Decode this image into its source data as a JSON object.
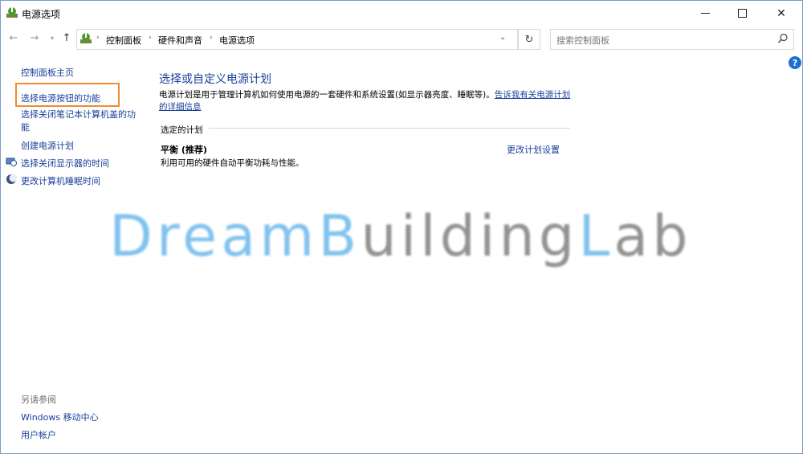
{
  "window": {
    "title": "电源选项",
    "buttons": {
      "minimize": "minimize",
      "maximize": "maximize",
      "close": "✕"
    }
  },
  "navigation": {
    "back_icon": "arrow-left-icon",
    "forward_icon": "arrow-right-icon",
    "dropdown_icon": "chevron-down-icon",
    "up_icon": "arrow-up-icon",
    "breadcrumbs": [
      "控制面板",
      "硬件和声音",
      "电源选项"
    ],
    "refresh_icon": "refresh-icon",
    "search": {
      "placeholder": "搜索控制面板"
    }
  },
  "help": {
    "label": "?"
  },
  "sidebar": {
    "links": [
      {
        "label": "控制面板主页"
      },
      {
        "label": "选择电源按钮的功能"
      },
      {
        "label": "选择关闭笔记本计算机盖的功能"
      },
      {
        "label": "创建电源计划"
      },
      {
        "label": "选择关闭显示器的时间"
      },
      {
        "label": "更改计算机睡眠时间"
      }
    ],
    "see_also": {
      "title": "另请参阅",
      "links": [
        {
          "label": "Windows 移动中心"
        },
        {
          "label": "用户帐户"
        }
      ]
    },
    "highlight_color": "#f28a2e"
  },
  "main": {
    "title": "选择或自定义电源计划",
    "description": "电源计划是用于管理计算机如何使用电源的一套硬件和系统设置(如显示器亮度、睡眠等)。",
    "learn_more": "告诉我有关电源计划的详细信息",
    "section_label": "选定的计划",
    "plan": {
      "name": "平衡 (推荐)",
      "description": "利用可用的硬件自动平衡功耗与性能。",
      "change_link": "更改计划设置"
    }
  },
  "watermark": {
    "parts": [
      "Dream",
      "B",
      "uilding",
      "L",
      "ab"
    ],
    "colors": {
      "blue": "#62b3ea",
      "gray": "#777777"
    }
  },
  "colors": {
    "link": "#1a3e9a",
    "accent": "#1f6fd1"
  }
}
